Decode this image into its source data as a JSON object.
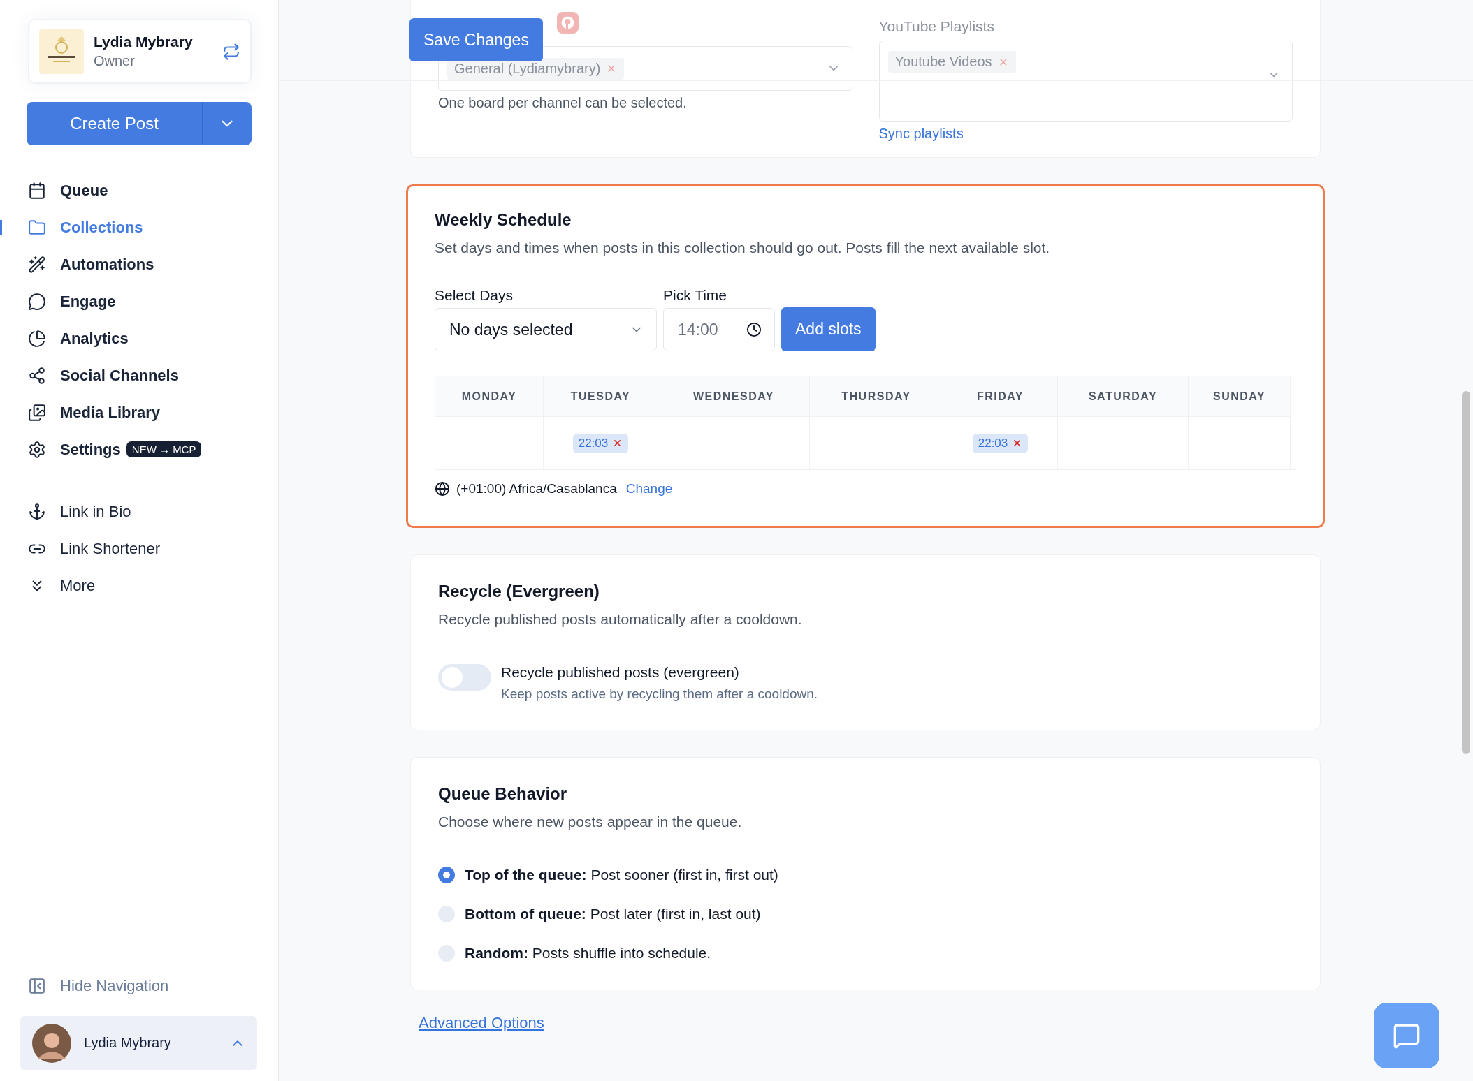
{
  "account": {
    "name": "Lydia Mybrary",
    "role": "Owner"
  },
  "create_button": {
    "label": "Create Post"
  },
  "nav": [
    {
      "label": "Queue",
      "selected": false
    },
    {
      "label": "Collections",
      "selected": true
    },
    {
      "label": "Automations",
      "selected": false
    },
    {
      "label": "Engage",
      "selected": false
    },
    {
      "label": "Analytics",
      "selected": false
    },
    {
      "label": "Social Channels",
      "selected": false
    },
    {
      "label": "Media Library",
      "selected": false
    },
    {
      "label": "Settings",
      "selected": false,
      "badge": "NEW → MCP"
    }
  ],
  "nav_secondary": [
    {
      "label": "Link in Bio"
    },
    {
      "label": "Link Shortener"
    },
    {
      "label": "More"
    }
  ],
  "hide_navigation": "Hide Navigation",
  "user": {
    "name": "Lydia Mybrary"
  },
  "header": {
    "save_button": "Save Changes"
  },
  "channels_card": {
    "pinterest_chip": "General (Lydiamybrary)",
    "pinterest_hint": "One board per channel can be selected.",
    "youtube_label": "YouTube Playlists",
    "youtube_chip": "Youtube Videos",
    "sync_link": "Sync playlists"
  },
  "weekly_schedule": {
    "title": "Weekly Schedule",
    "description": "Set days and times when posts in this collection should go out. Posts fill the next available slot.",
    "days_label": "Select Days",
    "days_value": "No days selected",
    "time_label": "Pick Time",
    "time_value": "14:00",
    "add_button": "Add slots",
    "days": [
      {
        "name": "MONDAY"
      },
      {
        "name": "TUESDAY",
        "slots": [
          "22:03"
        ]
      },
      {
        "name": "WEDNESDAY"
      },
      {
        "name": "THURSDAY"
      },
      {
        "name": "FRIDAY",
        "slots": [
          "22:03"
        ]
      },
      {
        "name": "SATURDAY"
      },
      {
        "name": "SUNDAY"
      }
    ],
    "timezone": "(+01:00) Africa/Casablanca",
    "change_link": "Change"
  },
  "recycle": {
    "title": "Recycle (Evergreen)",
    "description": "Recycle published posts automatically after a cooldown.",
    "toggle_label": "Recycle published posts (evergreen)",
    "toggle_hint": "Keep posts active by recycling them after a cooldown.",
    "on": false
  },
  "queue_behavior": {
    "title": "Queue Behavior",
    "description": "Choose where new posts appear in the queue.",
    "options": [
      {
        "label": "Top of the queue:",
        "detail": "Post sooner (first in, first out)",
        "selected": true
      },
      {
        "label": "Bottom of queue:",
        "detail": "Post later (first in, last out)",
        "selected": false
      },
      {
        "label": "Random:",
        "detail": "Posts shuffle into schedule.",
        "selected": false
      }
    ]
  },
  "advanced_link": "Advanced Options"
}
